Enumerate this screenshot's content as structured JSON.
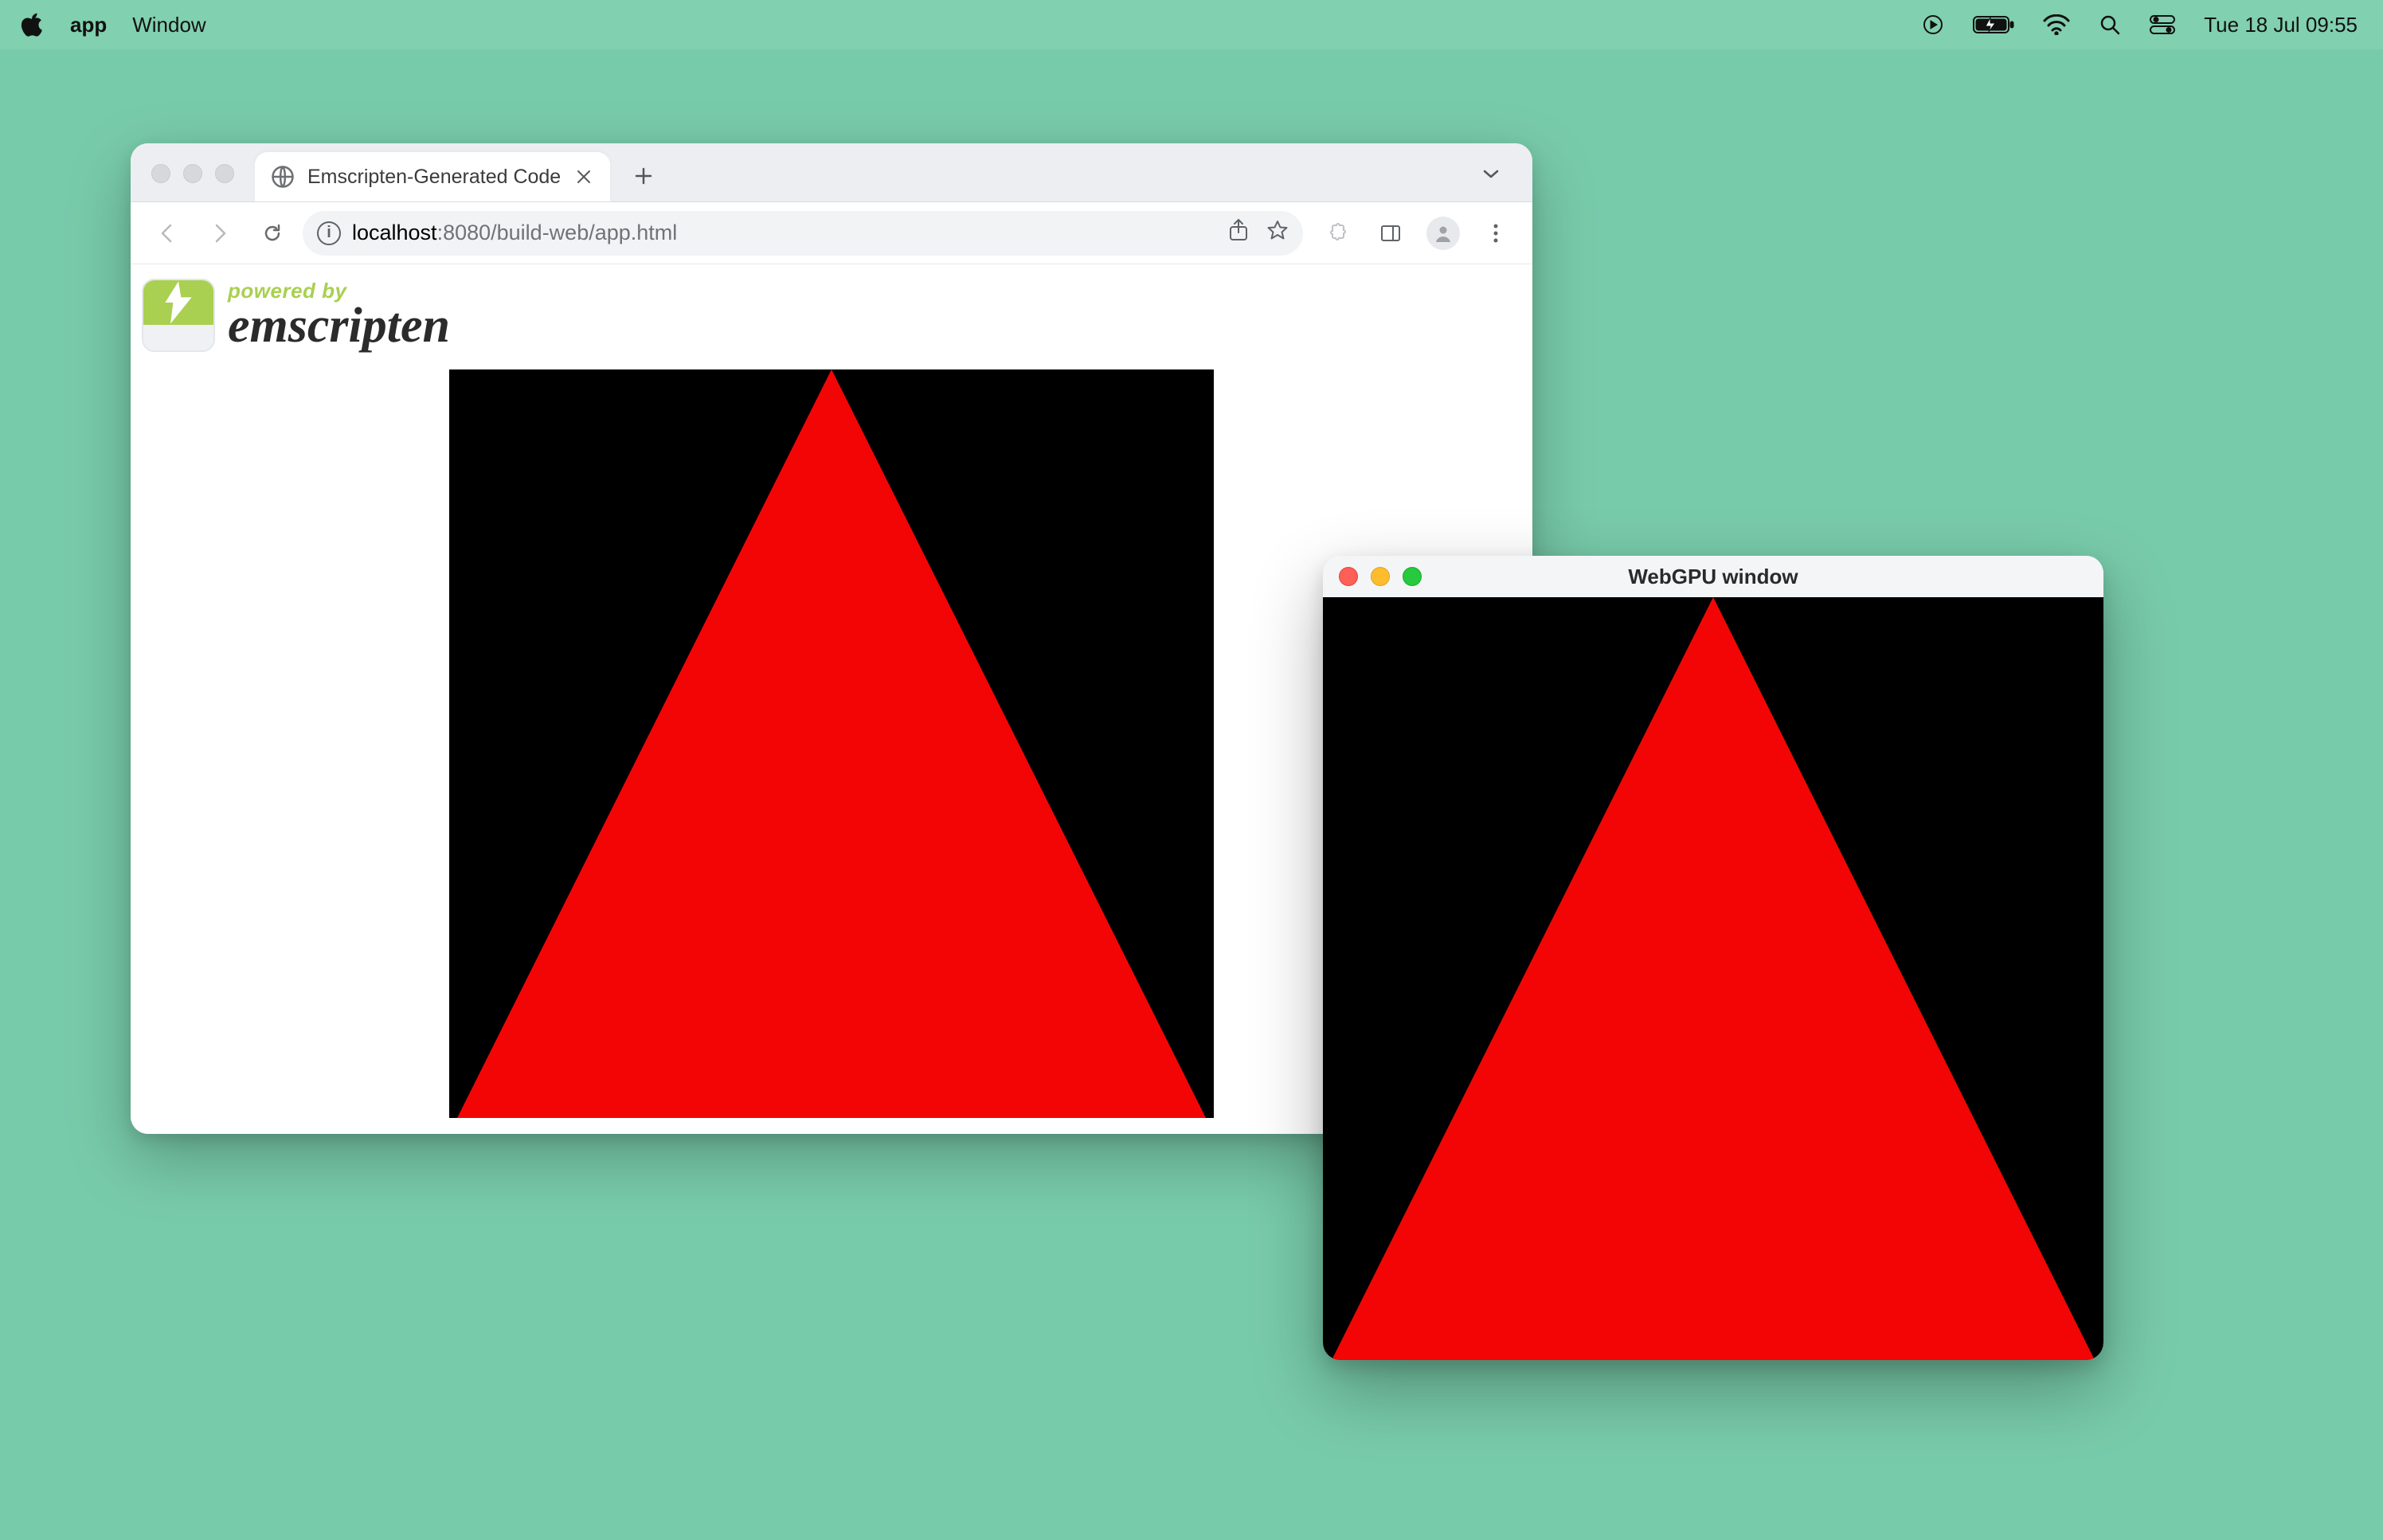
{
  "menubar": {
    "app_name": "app",
    "menu_items": [
      "Window"
    ],
    "clock": "Tue 18 Jul  09:55"
  },
  "browser": {
    "tab_title": "Emscripten-Generated Code",
    "url_host": "localhost",
    "url_rest": ":8080/build-web/app.html"
  },
  "page": {
    "powered_by": "powered by",
    "emscripten": "emscripten"
  },
  "native": {
    "title": "WebGPU window"
  }
}
